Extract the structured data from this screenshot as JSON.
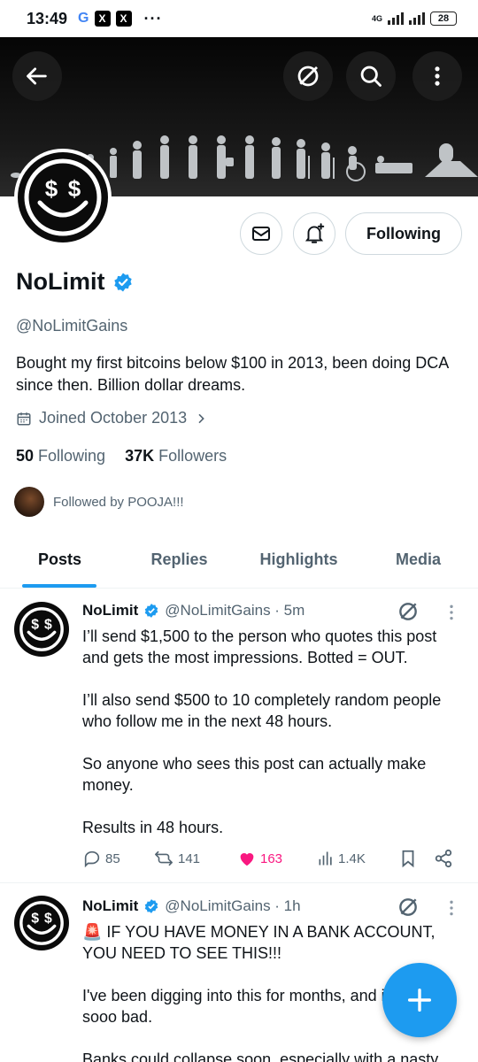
{
  "status_bar": {
    "time": "13:49",
    "google": "G",
    "x1": "X",
    "x2": "X",
    "more": "···",
    "network": "4G",
    "battery": "28"
  },
  "profile": {
    "name": "NoLimit",
    "handle": "@NoLimitGains",
    "bio": "Bought my first bitcoins below $100 in 2013, been doing DCA since then. Billion dollar dreams.",
    "joined": "Joined October 2013",
    "following_count": "50",
    "following_label": "Following",
    "followers_count": "37K",
    "followers_label": "Followers",
    "followed_by": "Followed by POOJA!!!",
    "follow_button": "Following",
    "avatar_text": "$ $"
  },
  "tabs": [
    {
      "label": "Posts"
    },
    {
      "label": "Replies"
    },
    {
      "label": "Highlights"
    },
    {
      "label": "Media"
    }
  ],
  "posts": [
    {
      "name": "NoLimit",
      "handle_time": "@NoLimitGains · 5m",
      "paragraphs": [
        "I’ll send $1,500 to the person who quotes this post and gets the most impressions. Botted = OUT.",
        "I’ll also send $500 to 10 completely random people who follow me in the next 48 hours.",
        "So anyone who sees this post can actually make money.",
        "Results in 48 hours."
      ],
      "replies": "85",
      "reposts": "141",
      "likes": "163",
      "views": "1.4K"
    },
    {
      "name": "NoLimit",
      "handle_time": "@NoLimitGains · 1h",
      "paragraphs": [
        "🚨 IF YOU HAVE MONEY IN A BANK ACCOUNT, YOU NEED TO SEE THIS!!!",
        "I've been digging into this for months, and it's looking sooo bad.",
        "Banks could collapse soon, especially with a nasty"
      ]
    }
  ],
  "colors": {
    "accent": "#1d9bf0",
    "like": "#f91880",
    "text": "#0f1419",
    "muted": "#536471"
  }
}
